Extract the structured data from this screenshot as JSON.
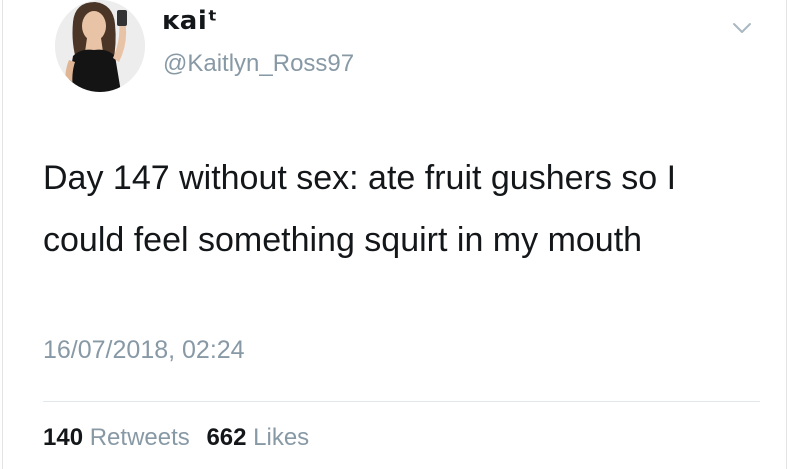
{
  "tweet": {
    "display_name": "ĸaiᵗ",
    "handle": "@Kaitlyn_Ross97",
    "text": "Day 147 without sex: ate fruit gushers so I could feel something squirt in my mouth",
    "timestamp": "16/07/2018, 02:24",
    "retweet_count": "140",
    "retweet_label": "Retweets",
    "like_count": "662",
    "like_label": "Likes"
  },
  "icons": {
    "avatar": "profile-photo",
    "menu": "chevron-down-icon"
  },
  "colors": {
    "text": "#14171a",
    "secondary": "#8899a6",
    "divider": "#e1e8ed",
    "background": "#ffffff"
  }
}
